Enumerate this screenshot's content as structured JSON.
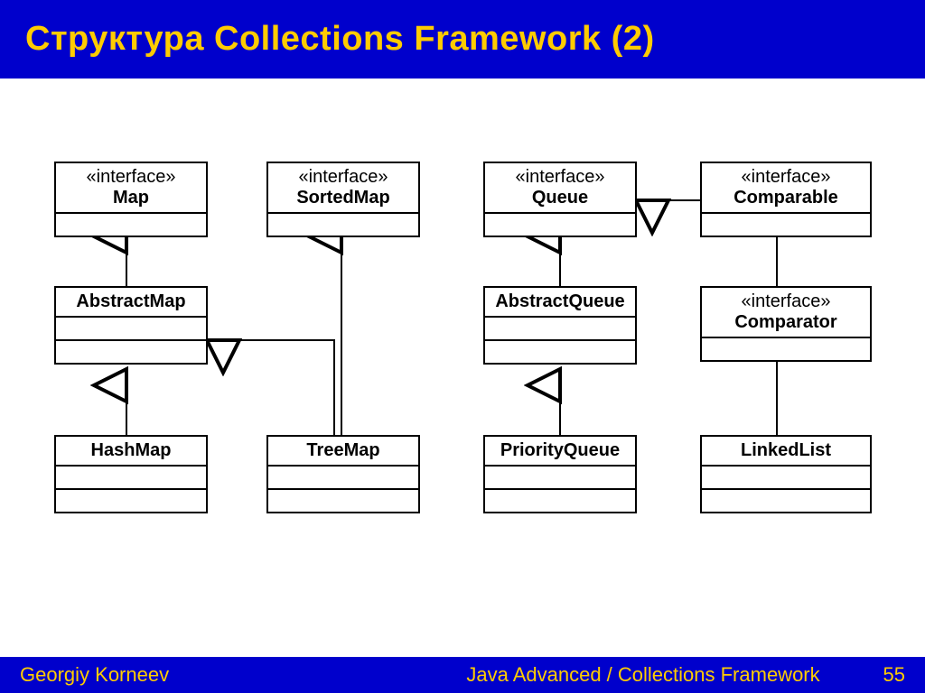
{
  "title": "Структура Collections Framework (2)",
  "footer": {
    "author": "Georgiy Korneev",
    "center": "Java Advanced / Collections Framework",
    "page": "55"
  },
  "boxes": {
    "map": {
      "stereo": "«interface»",
      "name": "Map"
    },
    "sortedmap": {
      "stereo": "«interface»",
      "name": "SortedMap"
    },
    "queue": {
      "stereo": "«interface»",
      "name": "Queue"
    },
    "comparable": {
      "stereo": "«interface»",
      "name": "Comparable"
    },
    "abstractmap": {
      "name": "AbstractMap"
    },
    "abstractqueue": {
      "name": "AbstractQueue"
    },
    "comparator": {
      "stereo": "«interface»",
      "name": "Comparator"
    },
    "hashmap": {
      "name": "HashMap"
    },
    "treemap": {
      "name": "TreeMap"
    },
    "priorityqueue": {
      "name": "PriorityQueue"
    },
    "linkedlist": {
      "name": "LinkedList"
    }
  },
  "relations": [
    {
      "from": "AbstractMap",
      "to": "Map",
      "kind": "implements"
    },
    {
      "from": "HashMap",
      "to": "AbstractMap",
      "kind": "extends"
    },
    {
      "from": "TreeMap",
      "to": "AbstractMap",
      "kind": "extends"
    },
    {
      "from": "TreeMap",
      "to": "SortedMap",
      "kind": "implements"
    },
    {
      "from": "AbstractQueue",
      "to": "Queue",
      "kind": "implements"
    },
    {
      "from": "PriorityQueue",
      "to": "AbstractQueue",
      "kind": "extends"
    },
    {
      "from": "LinkedList",
      "to": "Queue",
      "kind": "implements"
    }
  ]
}
